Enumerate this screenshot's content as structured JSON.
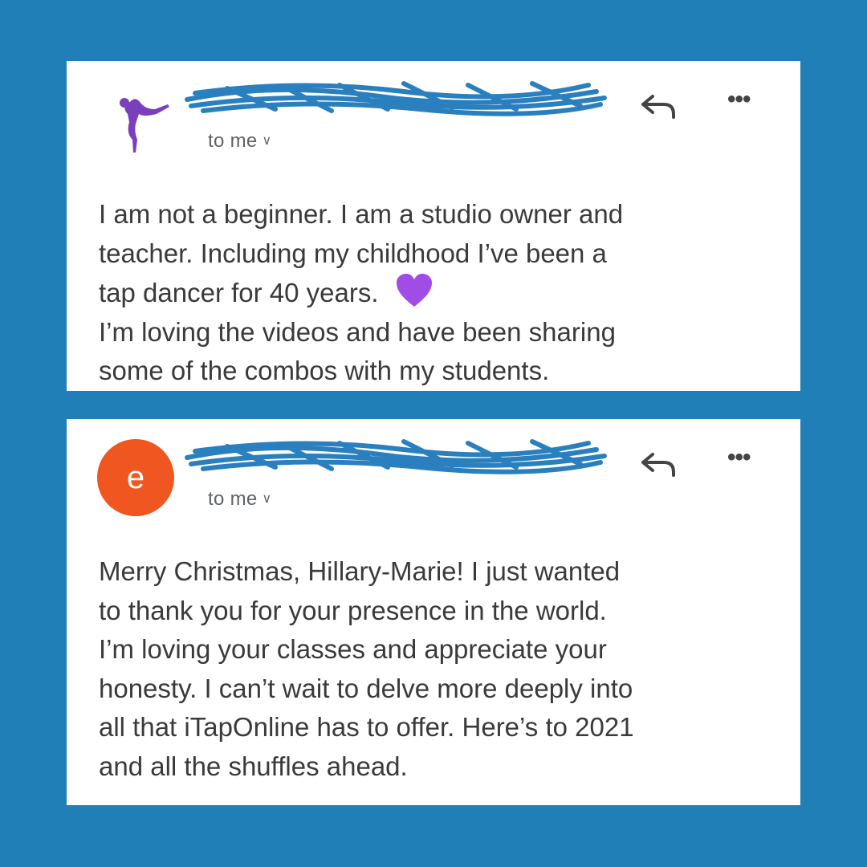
{
  "emails": [
    {
      "avatar": "dancer-logo",
      "recipient_label": "to me",
      "body_lines": [
        "I am not a beginner.  I am a studio owner and",
        "teacher.  Including my childhood I’ve been a",
        "tap dancer for 40 years.",
        "I’m loving the videos and have been sharing",
        "some of the combos with my students."
      ],
      "emoji": "purple-heart"
    },
    {
      "avatar": "letter",
      "avatar_letter": "e",
      "avatar_color": "#f0561f",
      "recipient_label": "to me",
      "body_lines": [
        "Merry Christmas, Hillary-Marie! I just wanted",
        "to thank you for your presence in the world.",
        "I’m loving your classes and appreciate your",
        "honesty. I can’t wait to delve more deeply into",
        "all that iTapOnline has to offer. Here’s to 2021",
        "and all the shuffles ahead."
      ]
    }
  ],
  "icons": {
    "reply": "reply-icon",
    "more": "more-options-icon",
    "chevron": "chevron-down-icon"
  },
  "colors": {
    "background": "#1f7fb6",
    "redaction": "#2a7fbf"
  }
}
